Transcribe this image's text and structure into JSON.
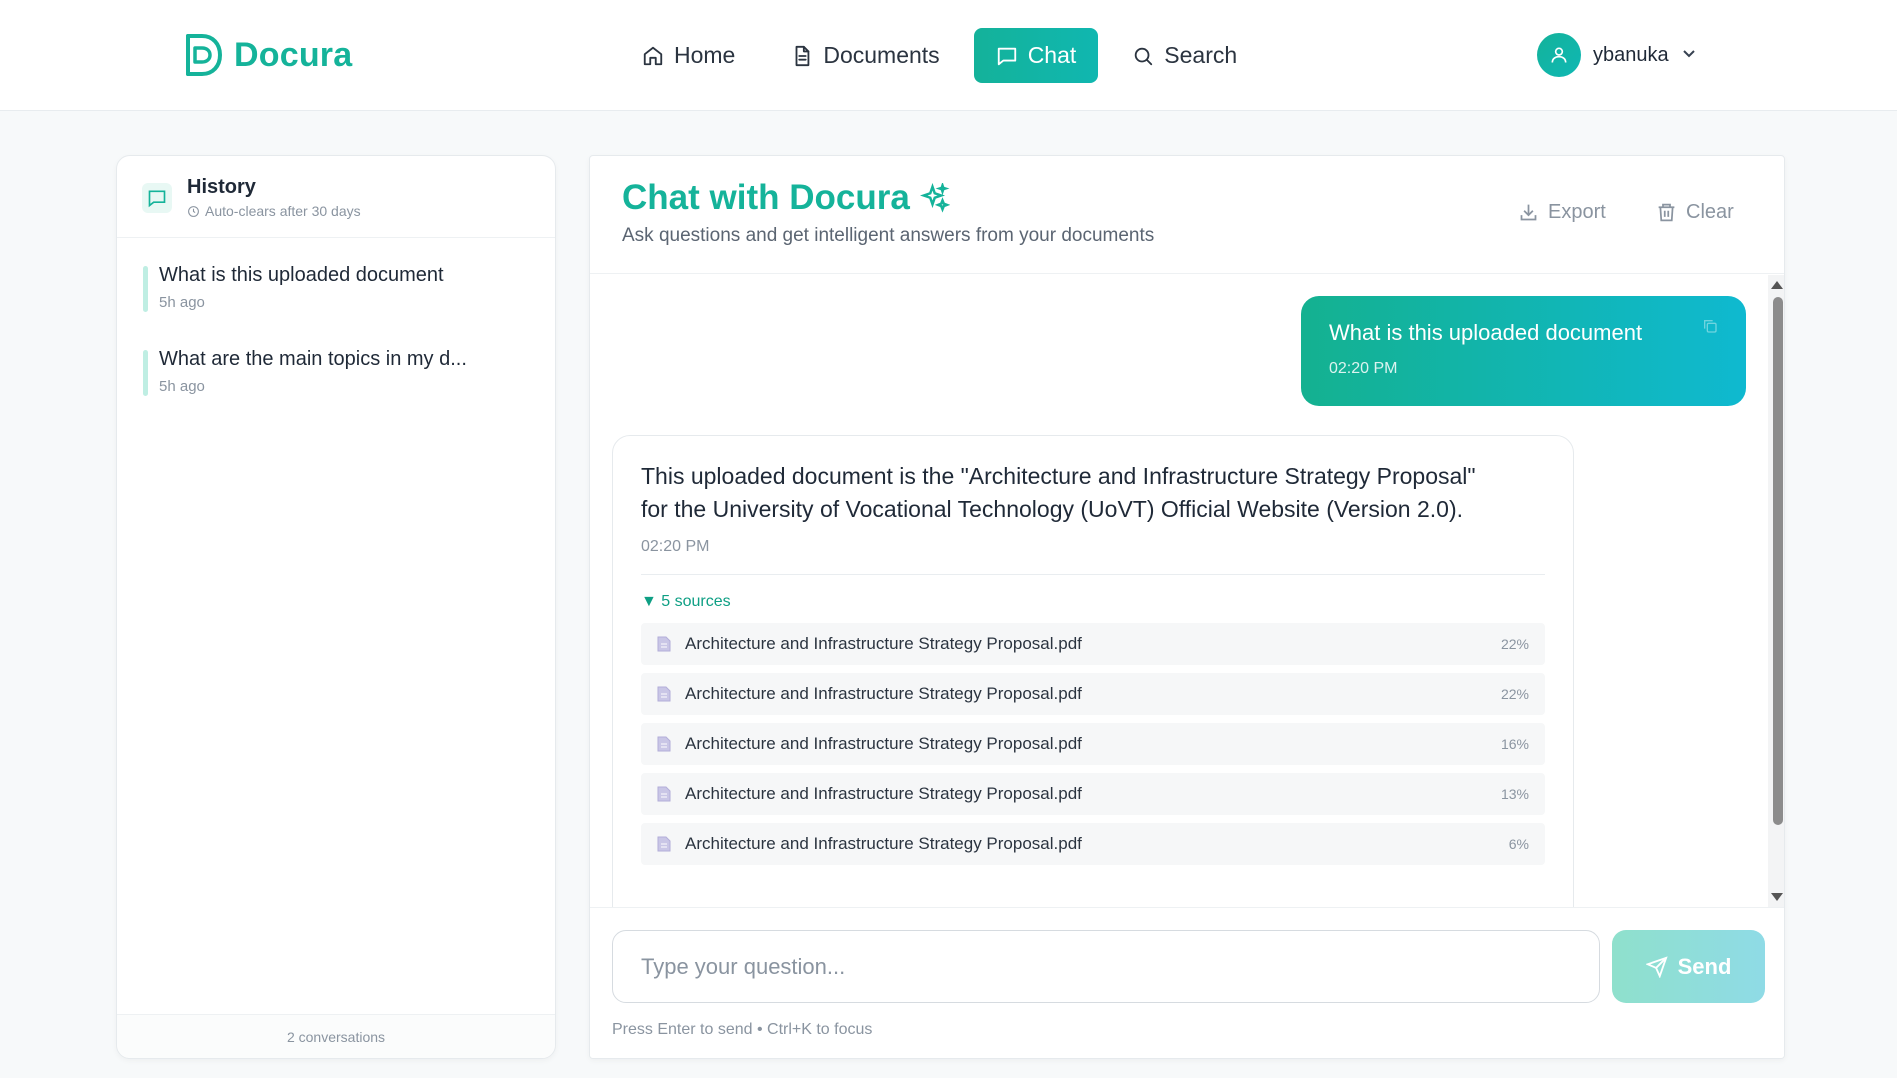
{
  "brand": {
    "name": "Docura",
    "color": "#15b39a"
  },
  "nav": [
    {
      "label": "Home",
      "icon": "home-icon"
    },
    {
      "label": "Documents",
      "icon": "document-icon"
    },
    {
      "label": "Chat",
      "icon": "chat-icon",
      "active": true
    },
    {
      "label": "Search",
      "icon": "search-icon"
    }
  ],
  "user": {
    "name": "ybanuka"
  },
  "sidebar": {
    "title": "History",
    "subtitle": "Auto-clears after 30 days",
    "items": [
      {
        "question": "What is this uploaded document",
        "time": "5h ago"
      },
      {
        "question": "What are the main topics in my d...",
        "time": "5h ago"
      }
    ],
    "footer": "2 conversations"
  },
  "main": {
    "title": "Chat with Docura",
    "subtitle": "Ask questions and get intelligent answers from your documents",
    "export_label": "Export",
    "clear_label": "Clear"
  },
  "messages": {
    "user": {
      "text": "What is this uploaded document",
      "time": "02:20 PM"
    },
    "assistant": {
      "text": "This uploaded document is the \"Architecture and Infrastructure Strategy Proposal\" for the University of Vocational Technology (UoVT) Official Website (Version 2.0).",
      "time": "02:20 PM",
      "sources_label": "▼ 5 sources",
      "sources": [
        {
          "name": "Architecture and Infrastructure Strategy Proposal.pdf",
          "score": "22%"
        },
        {
          "name": "Architecture and Infrastructure Strategy Proposal.pdf",
          "score": "22%"
        },
        {
          "name": "Architecture and Infrastructure Strategy Proposal.pdf",
          "score": "16%"
        },
        {
          "name": "Architecture and Infrastructure Strategy Proposal.pdf",
          "score": "13%"
        },
        {
          "name": "Architecture and Infrastructure Strategy Proposal.pdf",
          "score": "6%"
        }
      ]
    }
  },
  "composer": {
    "placeholder": "Type your question...",
    "send_label": "Send",
    "hint": "Press Enter to send • Ctrl+K to focus"
  }
}
